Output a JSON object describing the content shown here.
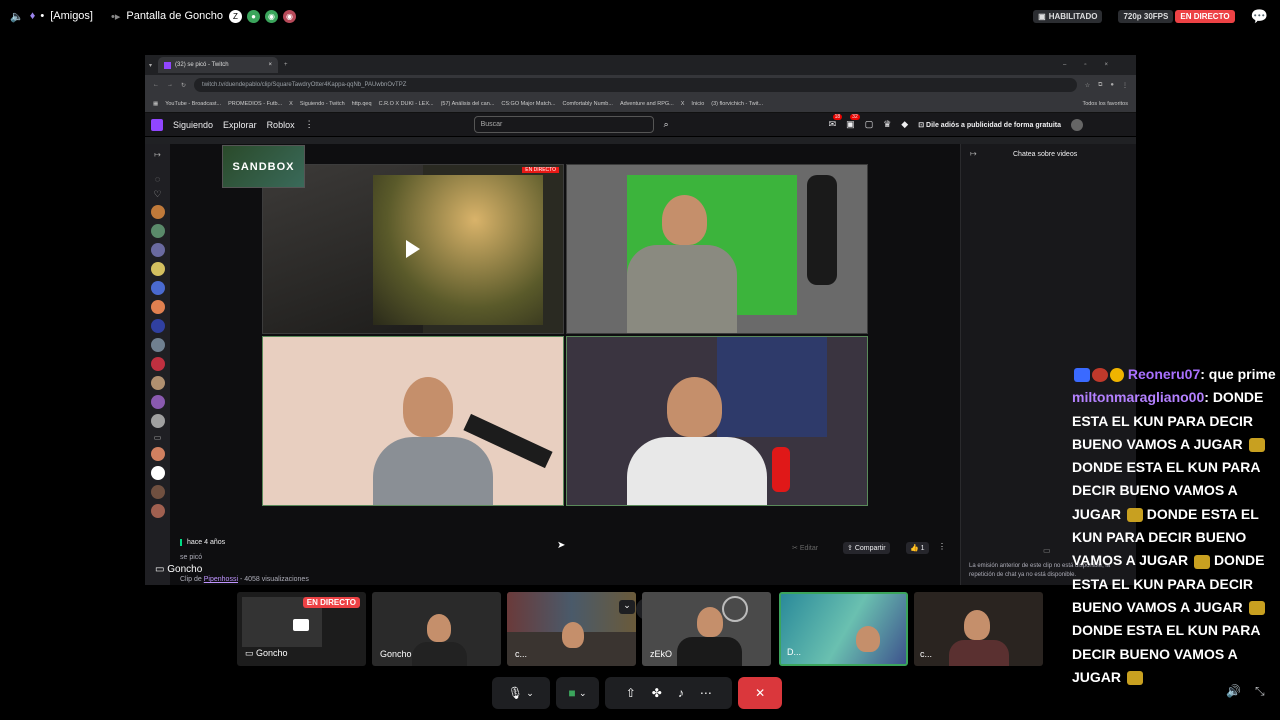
{
  "topbar": {
    "group_label": "[Amigos]",
    "screen_title": "Pantalla de Goncho",
    "badge_enabled": "HABILITADO",
    "quality_badge": "720p 30FPS",
    "live_badge": "EN DIRECTO"
  },
  "browser": {
    "tab_title": "(32) se picó - Twitch",
    "url": "twitch.tv/duendepablo/clip/SquareTawdryOtter4Kappa-qqNb_PAUwbnOvTPZ",
    "bookmarks": [
      "YouTube - Broadcast...",
      "PROMEDIOS - Futb...",
      "X",
      "Siguiendo - Twitch",
      "http.qeq",
      "C.R.O X DUKI - LEX...",
      "(57) Análisis del can...",
      "CS:GO Major Match...",
      "Comfortably Numb...",
      "Adventure and RPG...",
      "X",
      "Inicio",
      "(3) florvichich - Twit..."
    ],
    "all_favorites": "Todos los favoritos"
  },
  "twitch": {
    "nav_following": "Siguiendo",
    "nav_explore": "Explorar",
    "nav_roblox": "Roblox",
    "search_placeholder": "Buscar",
    "notif_1": "18",
    "notif_2": "32",
    "ad_free": "Dile adiós a publicidad de forma gratuita",
    "chat_title": "Chatea sobre videos",
    "chat_notice": "La emisión anterior de este clip no está disponible, la repetición de chat ya no está disponible.",
    "live_tag": "EN DIRECTO",
    "sandbox_logo": "SANDBOX",
    "clip_age": "hace 4 años",
    "clip_title": "se picó",
    "clip_by_prefix": "Clip de",
    "clip_author": "Pipenhossi",
    "clip_views": "- 4058 visualizaciones",
    "edit_label": "Editar",
    "share_label": "Compartir",
    "like_count": "1"
  },
  "stream_owner": "Goncho",
  "participants": [
    {
      "name": "Goncho",
      "live": "EN DIRECTO"
    },
    {
      "name": "Goncho"
    },
    {
      "name": "c..."
    },
    {
      "name": "zEkO"
    },
    {
      "name": "D..."
    },
    {
      "name": "c..."
    }
  ],
  "chat": {
    "msg1_user": "Reoneru07",
    "msg1_text": ": que prime",
    "msg2_user": "miltonmaragliano00",
    "msg2_text": ": DONDE ESTA EL KUN PARA DECIR BUENO VAMOS A JUGAR",
    "msg2_text_b": "DONDE ESTA EL KUN PARA DECIR BUENO VAMOS A JUGAR",
    "msg2_text_c": "DONDE ESTA EL KUN PARA DECIR BUENO VAMOS A JUGAR",
    "msg2_text_d": "DONDE ESTA EL KUN PARA DECIR BUENO VAMOS A JUGAR",
    "msg2_text_e": "DONDE ESTA EL KUN PARA DECIR BUENO VAMOS A JUGAR"
  },
  "colors": {
    "twitch_purple": "#9146ff",
    "live_red": "#ed4245",
    "hangup_red": "#da373c"
  }
}
